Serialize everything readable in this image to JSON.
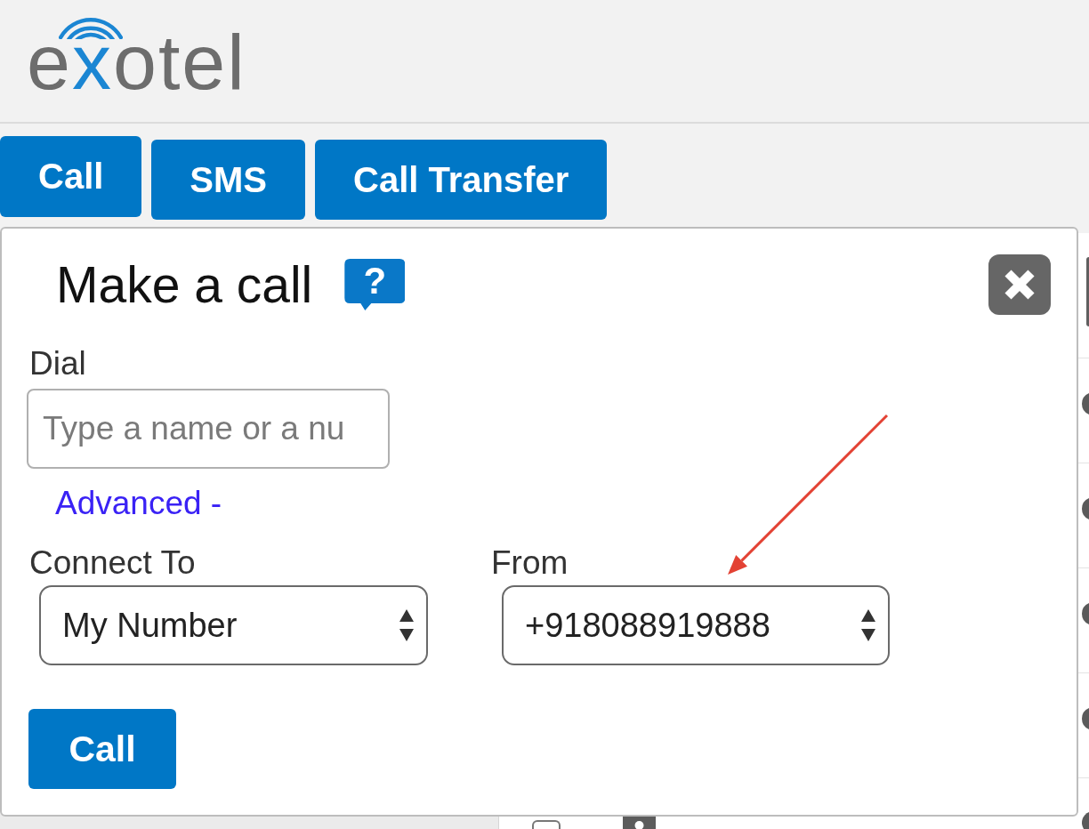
{
  "logo": "e**x**otel",
  "tabs": [
    {
      "label": "Call",
      "selected": true
    },
    {
      "label": "SMS",
      "selected": false
    },
    {
      "label": "Call Transfer",
      "selected": false
    }
  ],
  "dialog": {
    "title": "Make a call",
    "help": "?",
    "dial": {
      "label": "Dial",
      "placeholder": "Type a name or a nu"
    },
    "advanced_link": "Advanced -",
    "connect_to": {
      "label": "Connect To",
      "value": "My Number"
    },
    "from": {
      "label": "From",
      "value": "+918088919888"
    },
    "submit": "Call"
  },
  "list_row": {
    "checked": false
  }
}
